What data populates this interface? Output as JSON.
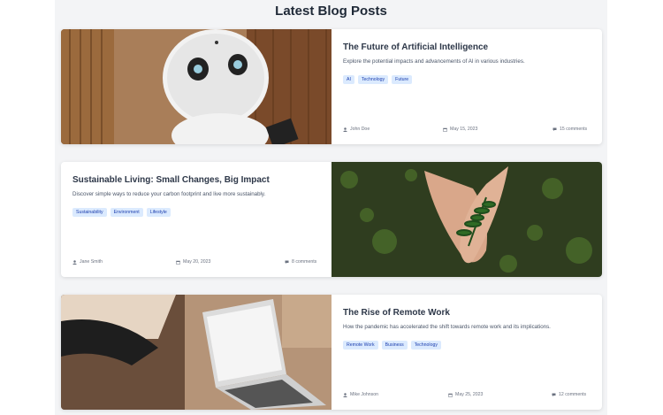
{
  "page_title": "Latest Blog Posts",
  "posts": [
    {
      "title": "The Future of Artificial Intelligence",
      "excerpt": "Explore the potential impacts and advancements of AI in various industries.",
      "tags": [
        "AI",
        "Technology",
        "Future"
      ],
      "author": "John Doe",
      "date": "May 15, 2023",
      "comments": "15 comments",
      "image": "robot-photo",
      "image_position": "left"
    },
    {
      "title": "Sustainable Living: Small Changes, Big Impact",
      "excerpt": "Discover simple ways to reduce your carbon footprint and live more sustainably.",
      "tags": [
        "Sustainability",
        "Environment",
        "Lifestyle"
      ],
      "author": "Jane Smith",
      "date": "May 20, 2023",
      "comments": "8 comments",
      "image": "plant-in-hands-photo",
      "image_position": "right"
    },
    {
      "title": "The Rise of Remote Work",
      "excerpt": "How the pandemic has accelerated the shift towards remote work and its implications.",
      "tags": [
        "Remote Work",
        "Business",
        "Technology"
      ],
      "author": "Mike Johnson",
      "date": "May 25, 2023",
      "comments": "12 comments",
      "image": "laptop-workspace-photo",
      "image_position": "left"
    }
  ],
  "colors": {
    "background": "#f3f4f6",
    "card": "#ffffff",
    "tag_bg": "#dbeafe",
    "tag_text": "#1e40af"
  }
}
